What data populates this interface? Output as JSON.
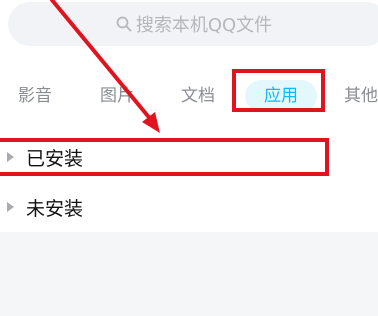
{
  "search": {
    "placeholder": "搜索本机QQ文件",
    "icon": "search-icon"
  },
  "tabs": [
    {
      "label": "影音"
    },
    {
      "label": "图片"
    },
    {
      "label": "文档"
    },
    {
      "label": "应用",
      "active": true
    },
    {
      "label": "其他"
    }
  ],
  "sections": [
    {
      "label": "已安装",
      "expanded": false
    },
    {
      "label": "未安装",
      "expanded": false
    }
  ],
  "colors": {
    "accent": "#12b7f5",
    "active_tab_bg": "#e2f8fc",
    "annotation_red": "#e0141e"
  }
}
